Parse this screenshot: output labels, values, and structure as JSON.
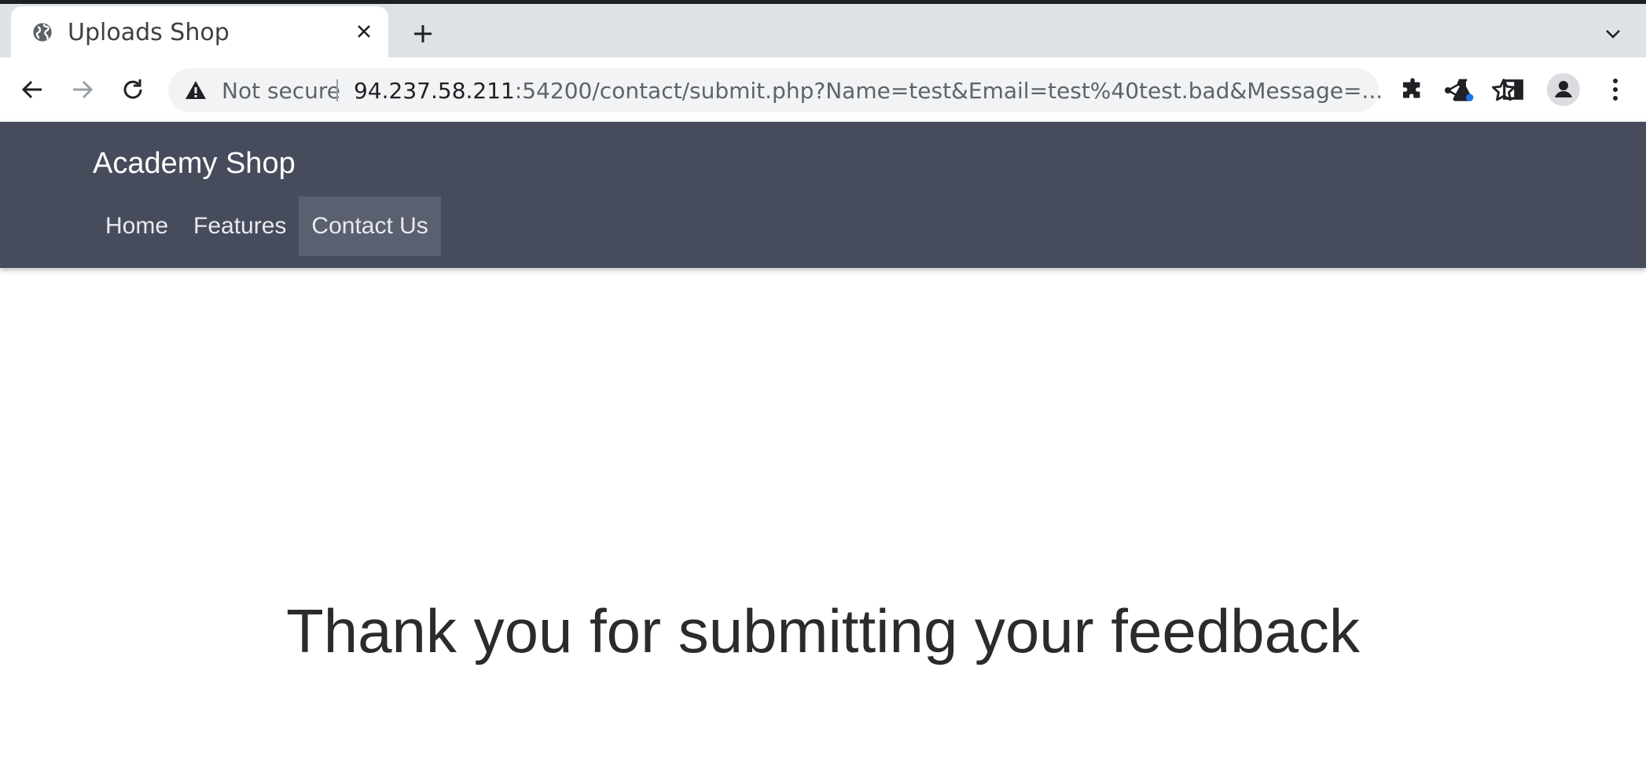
{
  "browser": {
    "tab": {
      "title": "Uploads Shop",
      "favicon": "globe-icon"
    },
    "address_bar": {
      "security_label": "Not secure",
      "url_host": "94.237.58.211",
      "url_rest": ":54200/contact/submit.php?Name=test&Email=test%40test.bad&Message=..."
    },
    "toolbar_icons": [
      "back-icon",
      "forward-icon",
      "reload-icon",
      "share-icon",
      "star-icon",
      "extensions-icon",
      "labs-icon",
      "side-panel-icon",
      "profile-icon",
      "menu-icon"
    ]
  },
  "site": {
    "brand": "Academy Shop",
    "nav": [
      {
        "label": "Home",
        "active": false
      },
      {
        "label": "Features",
        "active": false
      },
      {
        "label": "Contact Us",
        "active": true
      }
    ],
    "colors": {
      "navbar_bg": "#474c5c",
      "active_link_bg": "#5a6070"
    }
  },
  "main": {
    "message": "Thank you for submitting your feedback"
  }
}
